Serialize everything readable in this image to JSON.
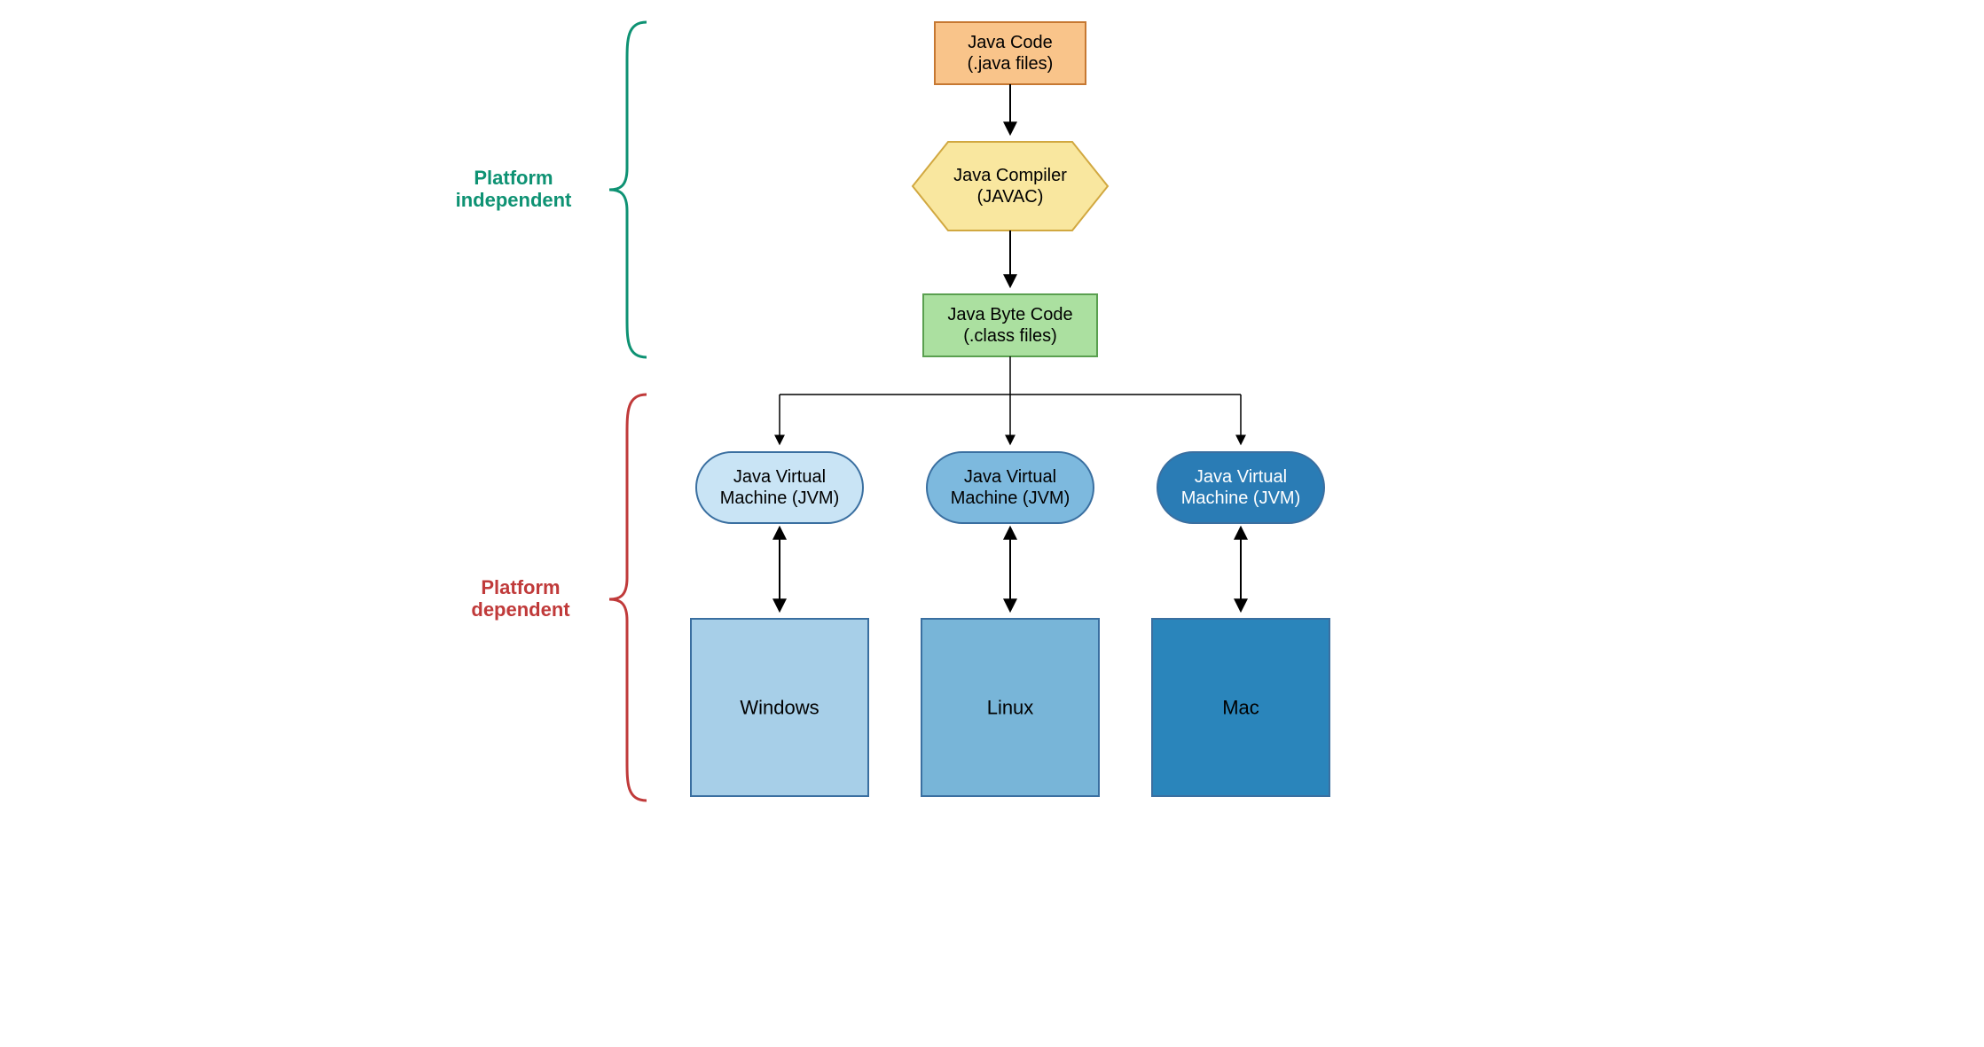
{
  "nodes": {
    "javaCode": {
      "line1": "Java Code",
      "line2": "(.java files)"
    },
    "javac": {
      "line1": "Java Compiler",
      "line2": "(JAVAC)"
    },
    "byteCode": {
      "line1": "Java Byte Code",
      "line2": "(.class files)"
    },
    "jvm1": {
      "line1": "Java Virtual",
      "line2": "Machine (JVM)"
    },
    "jvm2": {
      "line1": "Java Virtual",
      "line2": "Machine (JVM)"
    },
    "jvm3": {
      "line1": "Java Virtual",
      "line2": "Machine (JVM)"
    },
    "os1": {
      "label": "Windows"
    },
    "os2": {
      "label": "Linux"
    },
    "os3": {
      "label": "Mac"
    }
  },
  "labels": {
    "independent": {
      "line1": "Platform",
      "line2": "independent"
    },
    "dependent": {
      "line1": "Platform",
      "line2": "dependent"
    }
  },
  "colors": {
    "javaCodeFill": "#F9C48A",
    "javaCodeStroke": "#C67832",
    "javacFill": "#F9E79F",
    "javacStroke": "#D1A840",
    "byteCodeFill": "#ABE0A0",
    "byteCodeStroke": "#5AA050",
    "jvmLight": "#C9E4F5",
    "jvmMedium": "#7DB9DE",
    "jvmDark": "#2A7CB5",
    "jvmStroke": "#3A6FA0",
    "osLight": "#A7CFE8",
    "osMedium": "#78B5D8",
    "osDark": "#2A85BB",
    "independentLabel": "#0E9273",
    "dependentLabel": "#C03A3A",
    "independentBrace": "#0E9273",
    "dependentBrace": "#C03A3A"
  }
}
